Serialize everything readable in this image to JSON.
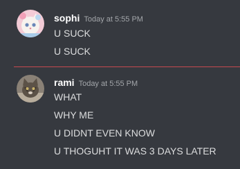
{
  "messages": [
    {
      "username": "sophi",
      "timestamp": "Today at 5:55 PM",
      "avatar_icon": "cat-avatar-icon",
      "lines": [
        "U SUCK",
        "U SUCK"
      ]
    },
    {
      "username": "rami",
      "timestamp": "Today at 5:55 PM",
      "avatar_icon": "cat-avatar-icon",
      "lines": [
        "WHAT",
        "WHY ME",
        "U DIDNT EVEN KNOW",
        "U THOGUHT IT WAS 3 DAYS LATER"
      ]
    }
  ],
  "colors": {
    "background": "#36393f",
    "username": "#ffffff",
    "timestamp": "#a3a6aa",
    "message_text": "#dcddde",
    "new_messages_divider": "#c84a4f"
  }
}
